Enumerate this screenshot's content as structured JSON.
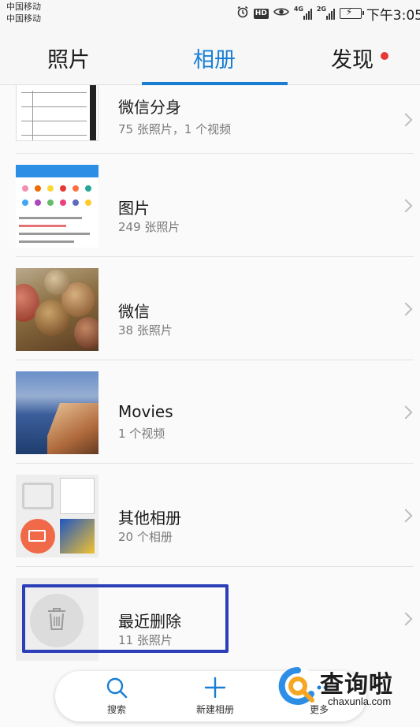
{
  "status_bar": {
    "carrier_1": "中国移动",
    "carrier_2": "中国移动",
    "hd": "HD",
    "net_1": "4G",
    "net_2": "2G",
    "time": "下午3:05"
  },
  "tabs": {
    "photos": "照片",
    "albums": "相册",
    "discover": "发现",
    "active": "相册"
  },
  "albums": [
    {
      "title": "微信分身",
      "subtitle": "75 张照片，1 个视频"
    },
    {
      "title": "图片",
      "subtitle": "249 张照片"
    },
    {
      "title": "微信",
      "subtitle": "38 张照片"
    },
    {
      "title": "Movies",
      "subtitle": "1 个视频"
    },
    {
      "title": "其他相册",
      "subtitle": "20 个相册"
    },
    {
      "title": "最近删除",
      "subtitle": "11 张照片"
    }
  ],
  "bottom_bar": {
    "search": "搜索",
    "new_album": "新建相册",
    "more": "更多"
  },
  "watermark": {
    "text": "查询啦",
    "url": "chaxunla.com"
  },
  "colors": {
    "accent": "#1a7fd4",
    "badge": "#e53935",
    "highlight": "#2c3fb8"
  }
}
